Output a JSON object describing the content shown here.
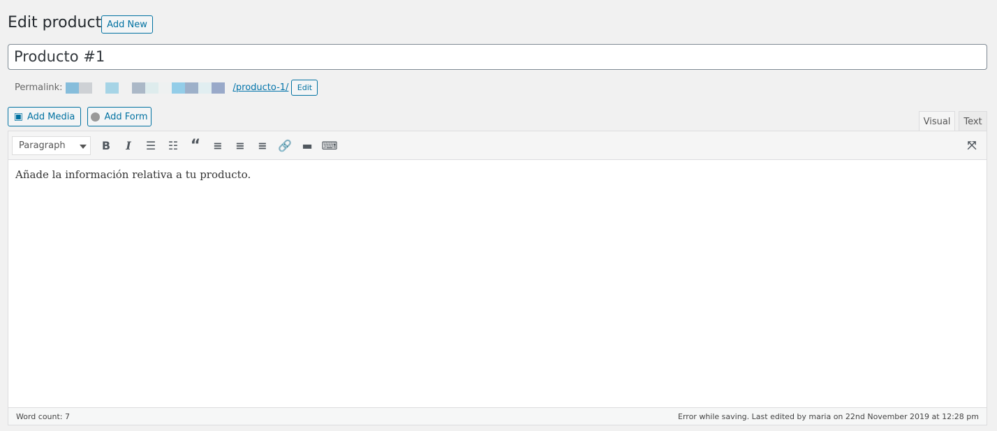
{
  "header": {
    "title": "Edit product",
    "add_new": "Add New"
  },
  "post_title": "Producto #1",
  "permalink": {
    "label": "Permalink:",
    "slug": "/producto-1/",
    "edit": "Edit",
    "blur_colors": [
      "#86bddb",
      "#ced1d5",
      "#f1f1f1",
      "#a6d4e6",
      "#f1f1f1",
      "#abb8c7",
      "#deeced",
      "#eef1f1",
      "#93cde8",
      "#9db0c9",
      "#e1eef1",
      "#99a9c9"
    ]
  },
  "media_buttons": {
    "add_media": "Add Media",
    "add_form": "Add Form"
  },
  "tabs": {
    "visual": "Visual",
    "text": "Text"
  },
  "toolbar": {
    "format": "Paragraph"
  },
  "content": "Añade la información relativa a tu producto.",
  "status": {
    "word_count": "Word count: 7",
    "saved": "Error while saving. Last edited by maria on 22nd November 2019 at 12:28 pm"
  }
}
